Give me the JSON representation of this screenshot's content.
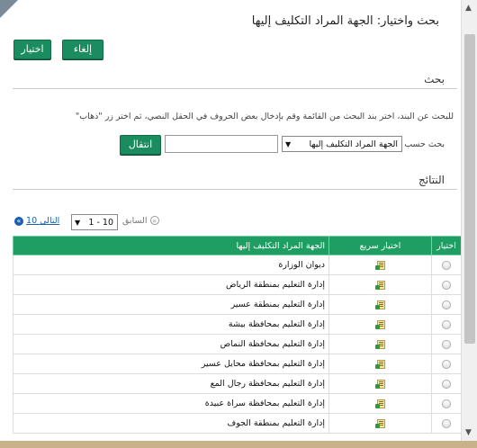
{
  "dialog": {
    "title": "بحث واختيار: الجهة المراد التكليف إليها",
    "cancel_label": "إلغاء",
    "select_label": "اختيار"
  },
  "search": {
    "section_title": "بحث",
    "instructions": "للبحث عن البند، اختر بند البحث من القائمة وقم بإدخال بعض الحروف في الحقل النصي، ثم اختر زر \"ذهاب\"",
    "search_by_label": "بحث حسب",
    "search_by_value": "الجهة المراد التكليف إليها",
    "text_value": "",
    "go_label": "انتقال"
  },
  "results": {
    "section_title": "النتائج",
    "pager": {
      "prev_label": "السابق",
      "range_value": "1 - 10",
      "next_label": "10 التالي"
    },
    "columns": {
      "select": "اختيار",
      "quick_select": "اختيار سريع",
      "entity": "الجهة المراد التكليف إليها"
    },
    "rows": [
      "ديوان الوزارة",
      "إدارة التعليم بمنطقة الرياض",
      "إدارة التعليم بمنطقة عسير",
      "إدارة التعليم بمحافظة بيشة",
      "إدارة التعليم بمحافظة النماص",
      "إدارة التعليم بمحافظة محايل عسير",
      "إدارة التعليم بمحافظة رجال المع",
      "إدارة التعليم بمحافظة سراة عبيدة",
      "إدارة التعليم بمنطقة الجوف"
    ]
  },
  "colors": {
    "accent_green": "#1e9e63",
    "button_green": "#1b8c5f",
    "link_blue": "#1a5fb4"
  }
}
